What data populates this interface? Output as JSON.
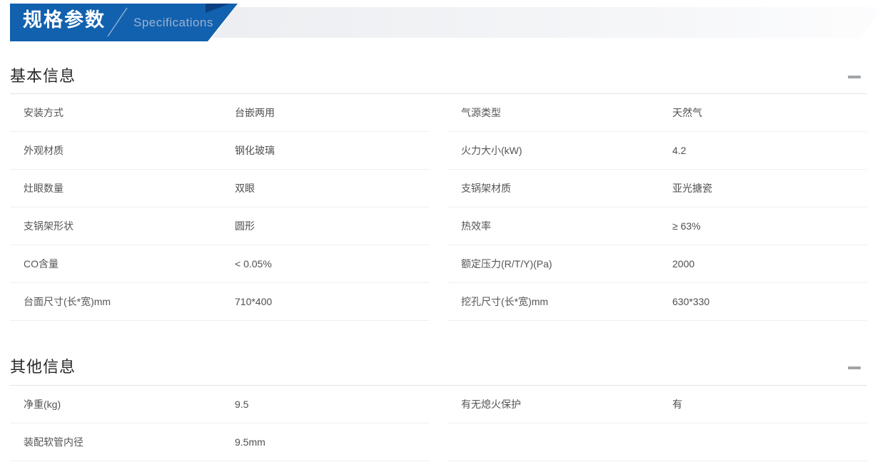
{
  "banner": {
    "title": "规格参数",
    "subtitle": "Specifications"
  },
  "colors": {
    "ribbon_blue": "#1261ae",
    "ribbon_fold": "#0a4080",
    "band_gray": "#eceef1",
    "subtitle_text": "#9cb2d1",
    "section_divider": "#e4e4e4",
    "row_divider": "#f0f0f0",
    "body_text": "#555555",
    "title_text": "#262626",
    "collapse_icon_gray": "#a1a4a8"
  },
  "sections": [
    {
      "title": "基本信息",
      "left": [
        {
          "label": "安装方式",
          "value": "台嵌两用"
        },
        {
          "label": "外观材质",
          "value": "钢化玻璃"
        },
        {
          "label": "灶眼数量",
          "value": "双眼"
        },
        {
          "label": "支锅架形状",
          "value": "圆形"
        },
        {
          "label": "CO含量",
          "value": "< 0.05%"
        },
        {
          "label": "台面尺寸(长*宽)mm",
          "value": "710*400"
        }
      ],
      "right": [
        {
          "label": "气源类型",
          "value": "天然气"
        },
        {
          "label": "火力大小(kW)",
          "value": "4.2"
        },
        {
          "label": "支锅架材质",
          "value": "亚光搪瓷"
        },
        {
          "label": "热效率",
          "value": "≥ 63%"
        },
        {
          "label": "额定压力(R/T/Y)(Pa)",
          "value": "2000"
        },
        {
          "label": "挖孔尺寸(长*宽)mm",
          "value": "630*330"
        }
      ]
    },
    {
      "title": "其他信息",
      "left": [
        {
          "label": "净重(kg)",
          "value": "9.5"
        },
        {
          "label": "装配软管内径",
          "value": "9.5mm"
        }
      ],
      "right": [
        {
          "label": "有无熄火保护",
          "value": "有"
        },
        {
          "label": "",
          "value": ""
        }
      ]
    }
  ]
}
